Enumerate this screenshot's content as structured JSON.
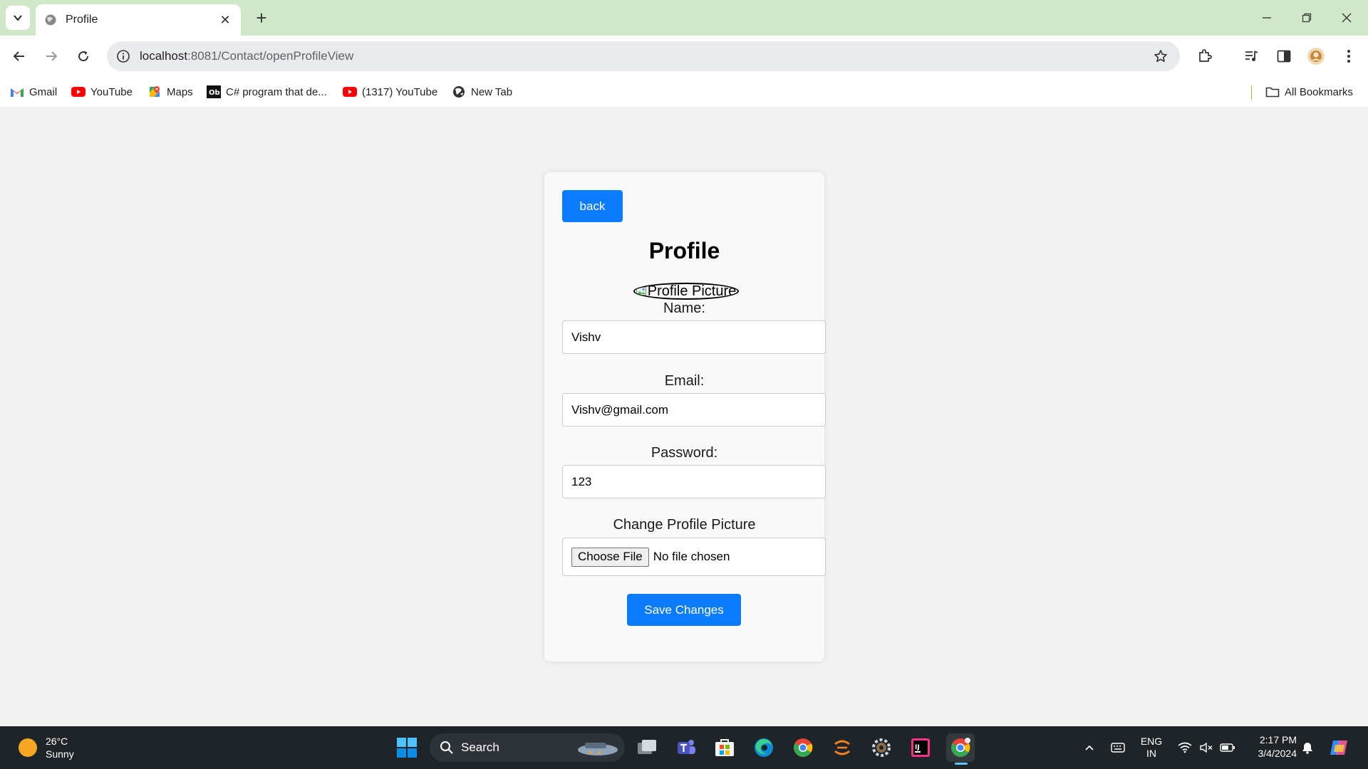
{
  "browser": {
    "tab_title": "Profile",
    "new_tab_symbol": "+",
    "url_host": "localhost",
    "url_path": ":8081/Contact/openProfileView",
    "bookmarks": [
      {
        "label": "Gmail",
        "icon": "gmail-icon"
      },
      {
        "label": "YouTube",
        "icon": "youtube-icon"
      },
      {
        "label": "Maps",
        "icon": "maps-icon"
      },
      {
        "label": "C# program that de...",
        "icon": "site-icon"
      },
      {
        "label": "(1317) YouTube",
        "icon": "youtube-icon"
      },
      {
        "label": "New Tab",
        "icon": "globe-icon"
      }
    ],
    "all_bookmarks": "All Bookmarks"
  },
  "page": {
    "back_label": "back",
    "title": "Profile",
    "picture_alt": "Profile Picture",
    "name_label": "Name:",
    "name_value": "Vishv",
    "email_label": "Email:",
    "email_value": "Vishv@gmail.com",
    "password_label": "Password:",
    "password_value": "123",
    "change_picture_label": "Change Profile Picture",
    "choose_file_label": "Choose File",
    "no_file_label": "No file chosen",
    "save_label": "Save Changes"
  },
  "taskbar": {
    "temperature": "26°C",
    "condition": "Sunny",
    "search_label": "Search",
    "lang_top": "ENG",
    "lang_bottom": "IN",
    "time": "2:17 PM",
    "date": "3/4/2024"
  },
  "colors": {
    "accent": "#0a7cff",
    "tabstrip": "#cfe8c8",
    "taskbar": "#1f2428"
  }
}
